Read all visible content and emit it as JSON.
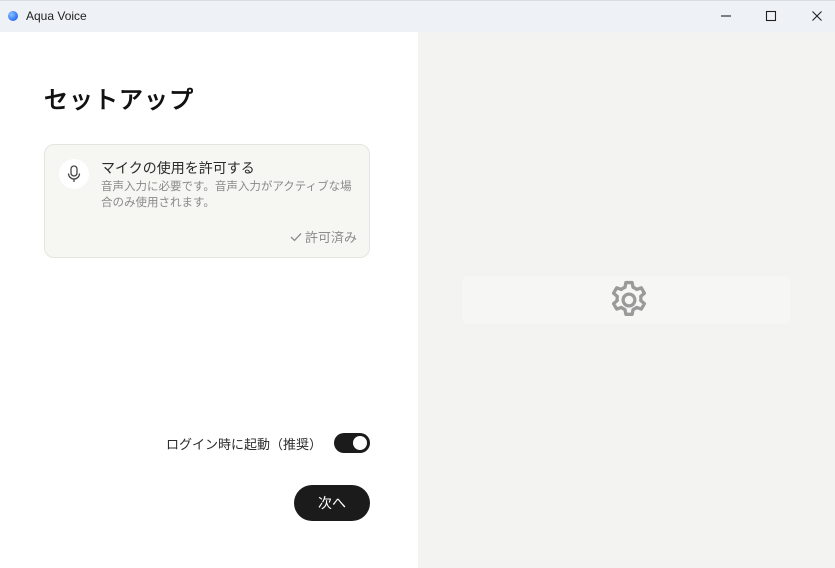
{
  "window": {
    "title": "Aqua Voice"
  },
  "setup": {
    "title": "セットアップ",
    "mic_card": {
      "title": "マイクの使用を許可する",
      "description": "音声入力に必要です。音声入力がアクティブな場合のみ使用されます。",
      "status": "許可済み"
    },
    "launch_at_login": {
      "label": "ログイン時に起動（推奨）",
      "enabled": true
    },
    "next_button": "次へ"
  },
  "colors": {
    "titlebar_bg": "#eef2f6",
    "right_pane_bg": "#f3f3f2",
    "primary_button": "#1b1b1b",
    "card_bg": "#f6f6f3",
    "muted_text": "#8a8a8a"
  },
  "icons": {
    "app": "aqua-voice-logo-icon",
    "mic": "microphone-icon",
    "status": "checkmark-icon",
    "preview": "gear-icon",
    "window_controls": [
      "minimize-icon",
      "maximize-icon",
      "close-icon"
    ]
  }
}
